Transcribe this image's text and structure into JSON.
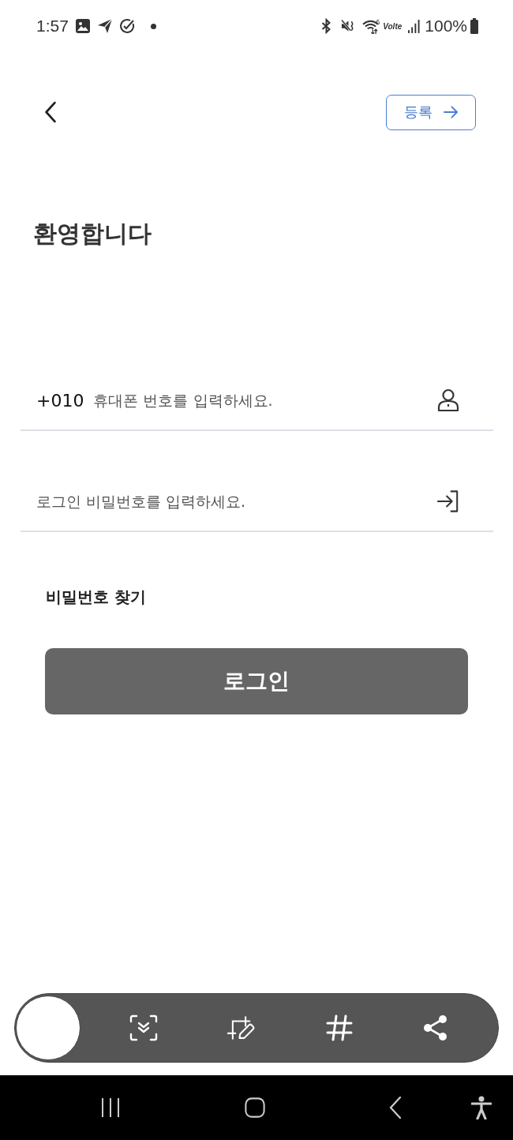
{
  "status_bar": {
    "time": "1:57",
    "wifi_label": "6",
    "network_label": "Volte",
    "battery": "100%"
  },
  "header": {
    "register_button": "등록"
  },
  "title": "환영합니다",
  "form": {
    "phone_field": {
      "prefix": "+010",
      "placeholder": "휴대폰 번호를 입력하세요."
    },
    "password_field": {
      "placeholder": "로그인 비밀번호를 입력하세요."
    },
    "find_password_link": "비밀번호 찾기",
    "login_button": "로그인"
  }
}
